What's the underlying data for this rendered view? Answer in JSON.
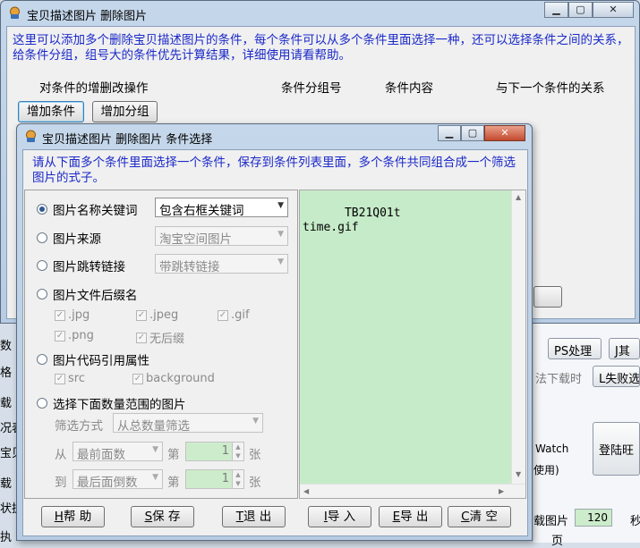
{
  "outer_dialog": {
    "title": "宝贝描述图片 删除图片",
    "info_text": "这里可以添加多个删除宝贝描述图片的条件，每个条件可以从多个条件里面选择一种，还可以选择条件之间的关系，给条件分组，组号大的条件优先计算结果，详细使用请看帮助。",
    "headers": {
      "ops": "对条件的增删改操作",
      "group_no": "条件分组号",
      "content": "条件内容",
      "relation": "与下一个条件的关系"
    },
    "buttons": {
      "add_condition": "增加条件",
      "add_group": "增加分组"
    }
  },
  "inner_dialog": {
    "title": "宝贝描述图片 删除图片 条件选择",
    "info_text": "请从下面多个条件里面选择一个条件，保存到条件列表里面，多个条件共同组合成一个筛选图片的式子。",
    "options": {
      "name_keyword": {
        "label": "图片名称关键词",
        "selected": true,
        "combo": "包含右框关键词"
      },
      "source": {
        "label": "图片来源",
        "combo": "淘宝空间图片"
      },
      "redirect": {
        "label": "图片跳转链接",
        "combo": "带跳转链接"
      },
      "suffix": {
        "label": "图片文件后缀名",
        "checks": [
          {
            "label": ".jpg",
            "checked": true
          },
          {
            "label": ".jpeg",
            "checked": true
          },
          {
            "label": ".gif",
            "checked": true
          },
          {
            "label": ".png",
            "checked": true
          },
          {
            "label": "无后缀",
            "checked": true
          }
        ]
      },
      "code_ref": {
        "label": "图片代码引用属性",
        "checks": [
          {
            "label": "src",
            "checked": true
          },
          {
            "label": "background",
            "checked": true
          }
        ]
      },
      "count_range": {
        "label": "选择下面数量范围的图片",
        "filter_label": "筛选方式",
        "filter_combo": "从总数量筛选",
        "from_label": "从",
        "from_combo": "最前面数",
        "from_nth": "第",
        "from_value": "1",
        "from_unit": "张",
        "to_label": "到",
        "to_combo": "最后面倒数",
        "to_nth": "第",
        "to_value": "1",
        "to_unit": "张"
      }
    },
    "keywords_text": "TB21Q01t\ntime.gif",
    "buttons": {
      "help_key": "H",
      "help": "帮  助",
      "save_key": "S",
      "save": "保 存",
      "exit_key": "T",
      "exit": "退  出",
      "import_key": "I",
      "import": "导  入",
      "export_key": "E",
      "export": "导  出",
      "clear_key": "C",
      "clear": "清  空"
    }
  },
  "background_app": {
    "left_fragments": [
      "数",
      "格",
      "载",
      "况表",
      "宝贝",
      "载",
      "状执",
      "执"
    ],
    "ps_button": "PS处理",
    "j_button": "J其",
    "fail_download": "法下载时",
    "fail_button": "L失败选",
    "watch_text": "Watch",
    "use_text": "使用)",
    "login_button": "登陆旺",
    "load_image": "载图片",
    "spin_value": "120",
    "seconds": "秒",
    "page": "页"
  },
  "colors": {
    "info_text": "#1b29c9",
    "keyword_area": "#c6ebc9",
    "spin_bg": "#cdeccb"
  }
}
